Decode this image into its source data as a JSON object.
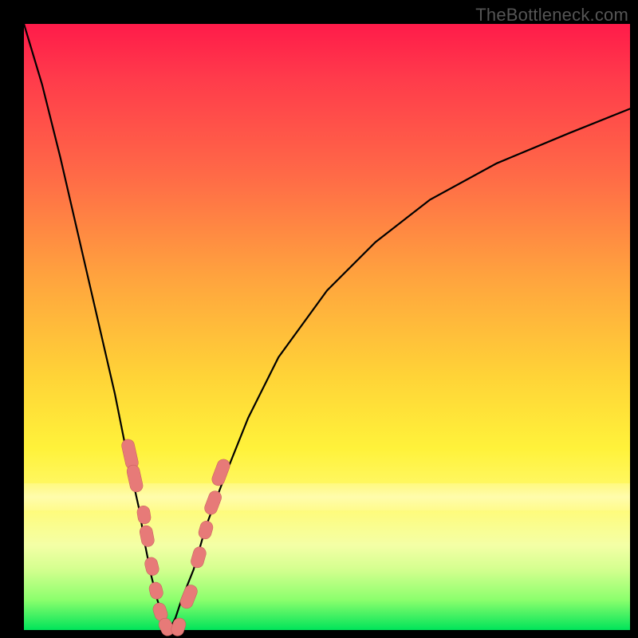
{
  "watermark": "TheBottleneck.com",
  "colors": {
    "frame": "#000000",
    "curve": "#000000",
    "marker_fill": "#e77a78",
    "marker_stroke": "#c45c5a",
    "gradient_top": "#ff1b4a",
    "gradient_bottom": "#00e45a"
  },
  "chart_data": {
    "type": "line",
    "title": "",
    "xlabel": "",
    "ylabel": "",
    "xlim": [
      0,
      1
    ],
    "ylim": [
      0,
      1
    ],
    "grid": false,
    "legend": false,
    "series": [
      {
        "name": "curve",
        "x": [
          0.0,
          0.03,
          0.06,
          0.09,
          0.12,
          0.15,
          0.17,
          0.19,
          0.2,
          0.21,
          0.22,
          0.23,
          0.24,
          0.25,
          0.26,
          0.28,
          0.3,
          0.33,
          0.37,
          0.42,
          0.5,
          0.58,
          0.67,
          0.78,
          0.9,
          1.0
        ],
        "y": [
          1.0,
          0.9,
          0.78,
          0.65,
          0.52,
          0.39,
          0.29,
          0.2,
          0.14,
          0.09,
          0.05,
          0.02,
          0.0,
          0.02,
          0.05,
          0.1,
          0.17,
          0.25,
          0.35,
          0.45,
          0.56,
          0.64,
          0.71,
          0.77,
          0.82,
          0.86
        ]
      }
    ],
    "markers": [
      {
        "x": 0.175,
        "y": 0.29,
        "len": 0.05
      },
      {
        "x": 0.183,
        "y": 0.25,
        "len": 0.045
      },
      {
        "x": 0.198,
        "y": 0.19,
        "len": 0.03
      },
      {
        "x": 0.203,
        "y": 0.155,
        "len": 0.035
      },
      {
        "x": 0.211,
        "y": 0.105,
        "len": 0.03
      },
      {
        "x": 0.218,
        "y": 0.065,
        "len": 0.028
      },
      {
        "x": 0.225,
        "y": 0.03,
        "len": 0.03
      },
      {
        "x": 0.235,
        "y": 0.005,
        "len": 0.03
      },
      {
        "x": 0.255,
        "y": 0.005,
        "len": 0.03
      },
      {
        "x": 0.272,
        "y": 0.055,
        "len": 0.04
      },
      {
        "x": 0.288,
        "y": 0.12,
        "len": 0.035
      },
      {
        "x": 0.3,
        "y": 0.165,
        "len": 0.03
      },
      {
        "x": 0.312,
        "y": 0.21,
        "len": 0.04
      },
      {
        "x": 0.325,
        "y": 0.26,
        "len": 0.045
      }
    ]
  }
}
